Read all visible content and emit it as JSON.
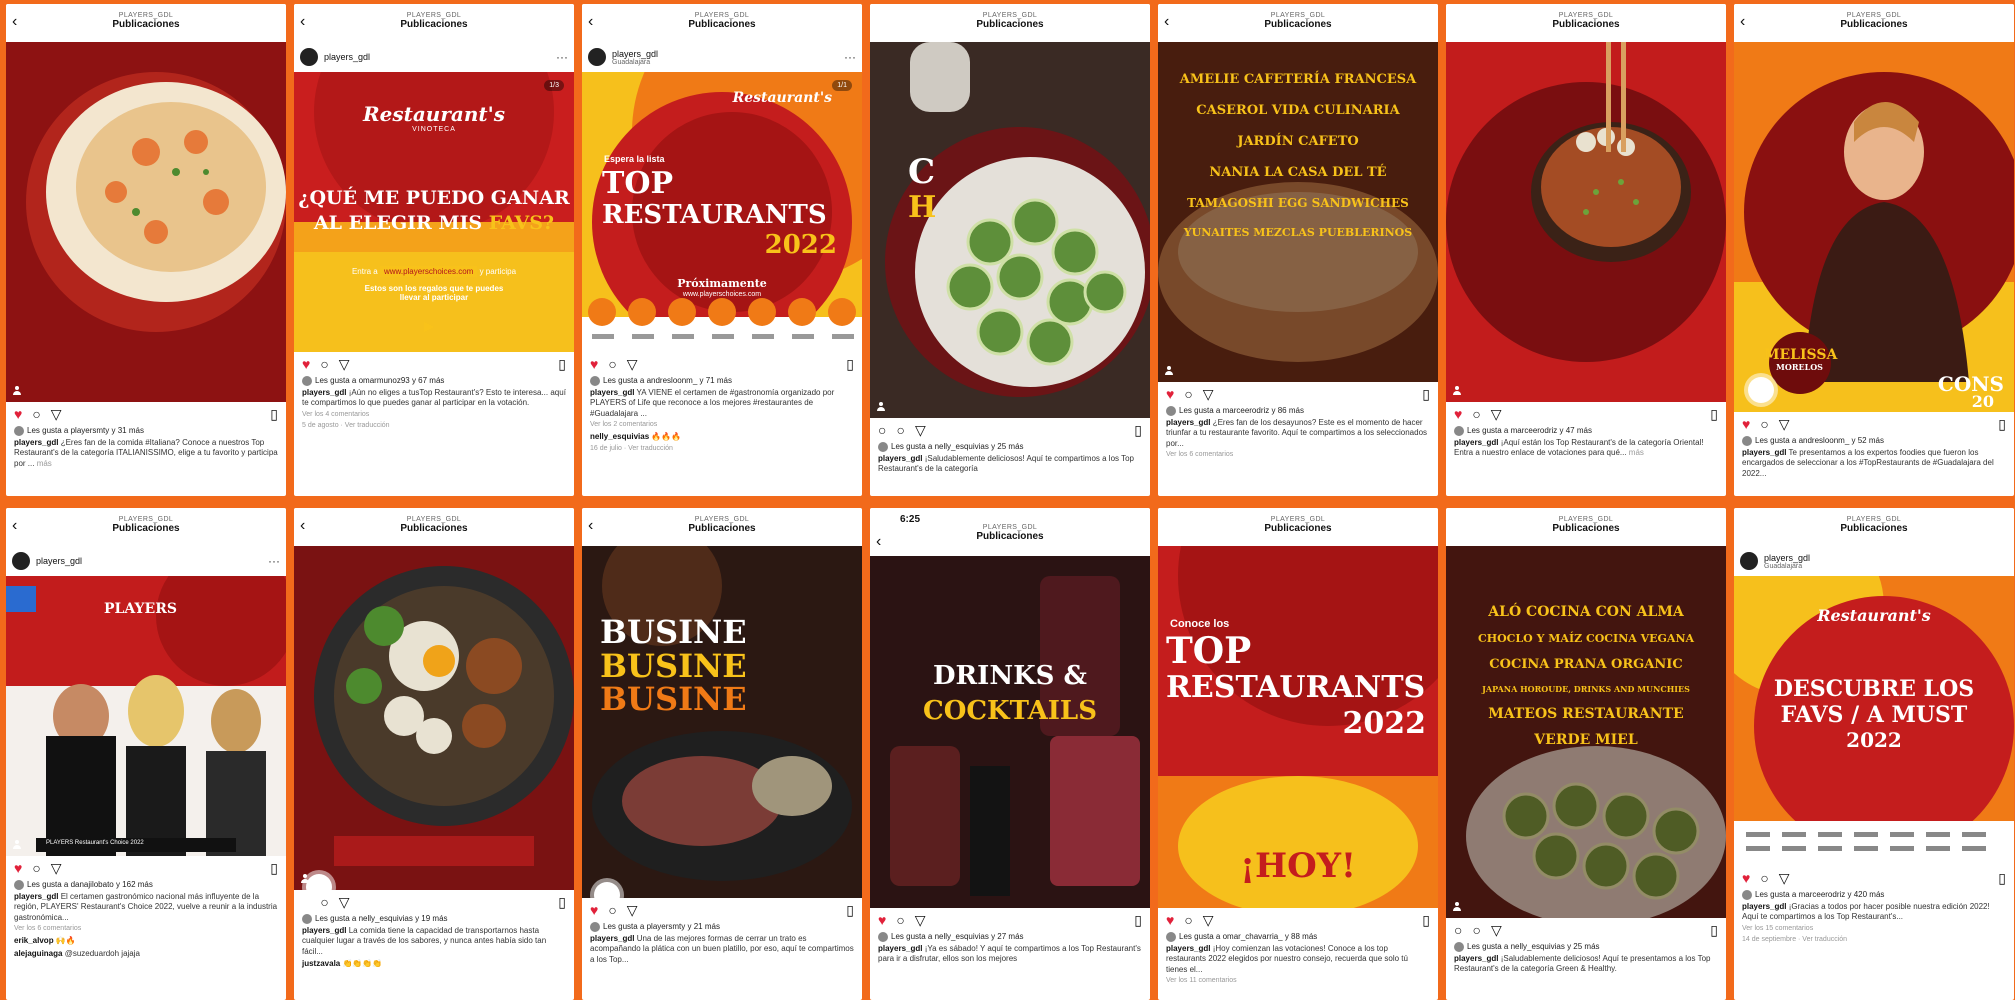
{
  "header": {
    "user": "PLAYERS_GDL",
    "title": "Publicaciones",
    "time": "6:25"
  },
  "account": {
    "name": "players_gdl",
    "location": "Guadalajara"
  },
  "icons": {
    "back": "‹",
    "heart": "♥",
    "comment": "○",
    "share": "▽",
    "save": "▯",
    "more": "···"
  },
  "colors": {
    "bg": "#f26a1b",
    "red": "#b3141c",
    "dark": "#6e0c0c",
    "yellow": "#f8c21a",
    "orange": "#f07a16"
  },
  "brand": {
    "restaurants": "Restaurant's",
    "vinoteca": "VINOTECA",
    "players": "PLAYERS"
  },
  "posts": [
    {
      "likes": "Les gusta a playersmty y 31 más",
      "caption": "¿Eres fan de la comida #Italiana? Conoce a nuestros Top Restaurant's de la categoría ITALIANISSIMO, elige a tu favorito y participa por ...",
      "meta": "",
      "more": "más"
    },
    {
      "text1": "¿QUÉ ME PUEDO GANAR",
      "text2": "AL ELEGIR MIS",
      "text3": "FAVS?",
      "entra1": "Entra a",
      "url": "www.playerschoices.com",
      "entra2": "y participa",
      "sub1": "Estos son los regalos que te puedes",
      "sub2": "llevar al participar",
      "likes": "Les gusta a omarmunoz93 y 67 más",
      "caption": "¡Aún no eliges a tusTop Restaurant's? Esto te interesa... aquí te compartimos lo que puedes ganar al participar en la votación.",
      "meta": "Ver los 4 comentarios",
      "meta2": "5 de agosto · Ver traducción",
      "badge": "1/3"
    },
    {
      "text1": "Espera la lista",
      "text2": "TOP",
      "text3": "RESTAURANTS",
      "text4": "2022",
      "text5": "Próximamente",
      "text6": "www.playerschoices.com",
      "likes": "Les gusta a andresloonm_ y 71 más",
      "caption": "YA VIENE el certamen de #gastronomía organizado por PLAYERS of Life que reconoce a los mejores #restaurantes de #Guadalajara ...",
      "meta": "Ver los 2 comentarios",
      "comment": "nelly_esquivias",
      "meta2": "16 de julio · Ver traducción",
      "badge": "1/1"
    },
    {
      "text1": "C",
      "text2": "H",
      "likes": "Les gusta a nelly_esquivias y 25 más",
      "caption": "¡Saludablemente deliciosos! Aquí te compartimos a los Top Restaurant's de la categoría"
    },
    {
      "lines": [
        "AMELIE CAFETERÍA FRANCESA",
        "CASEROL VIDA CULINARIA",
        "JARDÍN CAFETO",
        "NANIA LA CASA DEL TÉ",
        "TAMAGOSHI EGG SANDWICHES",
        "YUNAITES MEZCLAS PUEBLERINOS"
      ],
      "likes": "Les gusta a marceerodriz y 86 más",
      "caption": "¿Eres fan de los desayunos? Este es el momento de hacer triunfar a tu restaurante favorito. Aquí te compartimos a los seleccionados por...",
      "meta": "Ver los 6 comentarios"
    },
    {
      "likes": "Les gusta a marceerodriz y 47 más",
      "caption": "¡Aquí están los Top Restaurant's de la categoría Oriental! Entra a nuestro enlace de votaciones para qué...",
      "more": "más"
    },
    {
      "name1": "MELISSA",
      "name2": "MORELOS",
      "text": "CONS",
      "num": "20",
      "likes": "Les gusta a andresloonm_ y 52 más",
      "caption": "Te presentamos a los expertos foodies que fueron los encargados de seleccionar a los #TopRestaurants de #Guadalajara del 2022...",
      "more": "más"
    },
    {
      "banner": "PLAYERS Restaurant's Choice 2022",
      "likes": "Les gusta a danajilobato y 162 más",
      "caption": "El certamen gastronómico nacional más influyente de la región, PLAYERS' Restaurant's Choice 2022, vuelve a reunir a la industria gastronómica...",
      "meta": "Ver los 6 comentarios",
      "c1": "erik_alvop",
      "c2": "alejaguinaga",
      "c2t": "@suzeduardoh jajaja"
    },
    {
      "likes": "Les gusta a nelly_esquivias y 19 más",
      "caption": "La comida tiene la capacidad de transportarnos hasta cualquier lugar a través de los sabores, y nunca antes había sido tan fácil...",
      "comment": "justzavala"
    },
    {
      "text1": "BUSINE",
      "likes": "Les gusta a playersmty y 21 más",
      "caption": "Una de las mejores formas de cerrar un trato es acompañando la plática con un buen platillo, por eso, aquí te compartimos a los Top..."
    },
    {
      "text1": "DRINKS &",
      "text2": "COCKTAILS",
      "likes": "Les gusta a nelly_esquivias y 27 más",
      "caption": "¡Ya es sábado! Y aquí te compartimos a los Top Restaurant's para ir a disfrutar, ellos son los mejores"
    },
    {
      "text1": "Conoce los",
      "text2": "TOP",
      "text3": "RESTAURANTS",
      "text4": "2022",
      "text5": "¡HOY!",
      "likes": "Les gusta a omar_chavarria_ y 88 más",
      "caption": "¡Hoy comienzan las votaciones! Conoce a los top restaurants 2022 elegidos por nuestro consejo, recuerda que solo tú tienes el...",
      "meta": "Ver los 11 comentarios"
    },
    {
      "lines": [
        "ALÓ COCINA CON ALMA",
        "CHOCLO Y MAÍZ COCINA VEGANA",
        "COCINA PRANA ORGANIC",
        "JAPANA HOROUDE, DRINKS AND MUNCHIES",
        "MATEOS RESTAURANTE",
        "VERDE MIEL"
      ],
      "likes": "Les gusta a nelly_esquivias y 25 más",
      "caption": "¡Saludablemente deliciosos! Aquí te presentamos a los Top Restaurant's de la categoría Green & Healthy."
    },
    {
      "text1": "DESCUBRE LOS",
      "text2": "FAVS / A MUST",
      "text3": "2022",
      "likes": "Les gusta a marceerodriz y 420 más",
      "caption": "¡Gracias a todos por hacer posible nuestra edición 2022! Aquí te compartimos a los Top Restaurant's...",
      "meta": "Ver los 15 comentarios",
      "meta2": "14 de septiembre · Ver traducción"
    }
  ]
}
